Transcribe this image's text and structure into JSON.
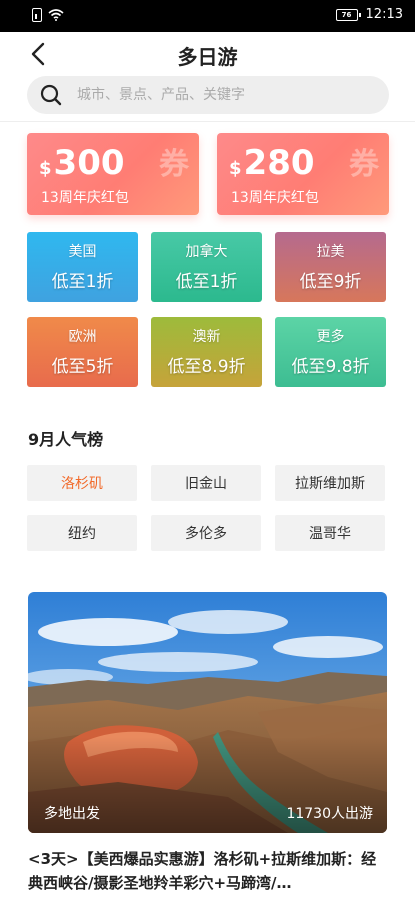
{
  "status_bar": {
    "time": "12:13",
    "battery": "76"
  },
  "header": {
    "title": "多日游",
    "back_icon": "back-arrow-icon"
  },
  "search": {
    "placeholder": "城市、景点、产品、关键字",
    "icon": "search-icon"
  },
  "coupons": [
    {
      "currency": "$",
      "amount": "300",
      "label": "13周年庆红包",
      "badge": "券"
    },
    {
      "currency": "$",
      "amount": "280",
      "label": "13周年庆红包",
      "badge": "券"
    }
  ],
  "destinations": [
    {
      "name": "美国",
      "discount": "低至1折"
    },
    {
      "name": "加拿大",
      "discount": "低至1折"
    },
    {
      "name": "拉美",
      "discount": "低至9折"
    },
    {
      "name": "欧洲",
      "discount": "低至5折"
    },
    {
      "name": "澳新",
      "discount": "低至8.9折"
    },
    {
      "name": "更多",
      "discount": "低至9.8折"
    }
  ],
  "ranking": {
    "title": "9月人气榜",
    "cities": [
      "洛杉矶",
      "旧金山",
      "拉斯维加斯",
      "纽约",
      "多伦多",
      "温哥华"
    ],
    "active_index": 0
  },
  "product": {
    "departure": "多地出发",
    "travelers": "11730人出游",
    "title": "<3天>【美西爆品实惠游】洛杉矶+拉斯维加斯：经典西峡谷/摄影圣地羚羊彩穴+马蹄湾/…"
  },
  "colors": {
    "accent": "#f26a2a",
    "coupon": "#ff7d74"
  }
}
